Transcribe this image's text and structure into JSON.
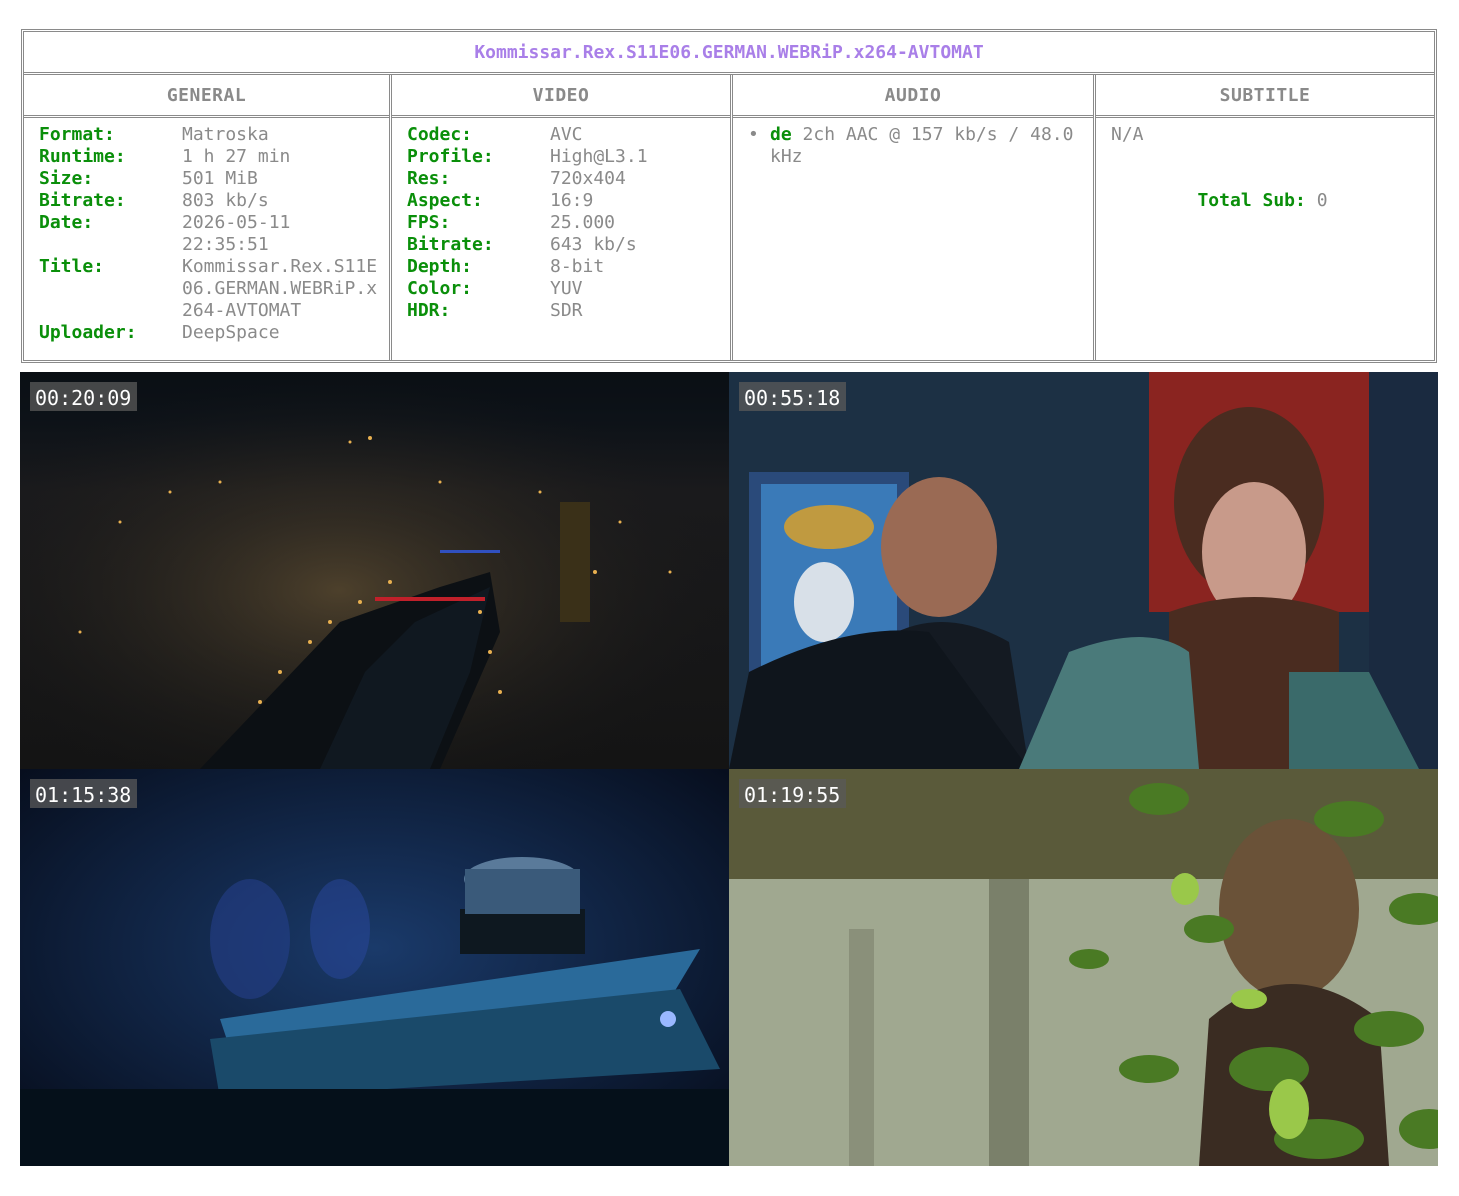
{
  "release_title": "Kommissar.Rex.S11E06.GERMAN.WEBRiP.x264-AVTOMAT",
  "general": {
    "header": "GENERAL",
    "rows": [
      {
        "key": "Format:",
        "value": "Matroska"
      },
      {
        "key": "Runtime:",
        "value": "1 h 27 min"
      },
      {
        "key": "Size:",
        "value": "501 MiB"
      },
      {
        "key": "Bitrate:",
        "value": "803 kb/s"
      },
      {
        "key": "Date:",
        "value": "2026-05-11 22:35:51"
      },
      {
        "key": "Title:",
        "value": "Kommissar.Rex.S11E06.GERMAN.WEBRiP.x264-AVTOMAT"
      },
      {
        "key": "Uploader:",
        "value": "DeepSpace"
      }
    ]
  },
  "video": {
    "header": "VIDEO",
    "rows": [
      {
        "key": "Codec:",
        "value": "AVC"
      },
      {
        "key": "Profile:",
        "value": "High@L3.1"
      },
      {
        "key": "Res:",
        "value": "720x404"
      },
      {
        "key": "Aspect:",
        "value": "16:9"
      },
      {
        "key": "FPS:",
        "value": "25.000"
      },
      {
        "key": "Bitrate:",
        "value": "643 kb/s"
      },
      {
        "key": "Depth:",
        "value": "8-bit"
      },
      {
        "key": "Color:",
        "value": "YUV"
      },
      {
        "key": "HDR:",
        "value": "SDR"
      }
    ]
  },
  "audio": {
    "header": "AUDIO",
    "tracks": [
      {
        "bullet": "•",
        "lang": "de",
        "desc": "2ch AAC @ 157 kb/s / 48.0 kHz"
      }
    ]
  },
  "subtitle": {
    "header": "SUBTITLE",
    "value": "N/A",
    "total_key": "Total Sub:",
    "total_value": "0"
  },
  "screenshots": [
    {
      "timestamp": "00:20:09"
    },
    {
      "timestamp": "00:55:18"
    },
    {
      "timestamp": "01:15:38"
    },
    {
      "timestamp": "01:19:55"
    }
  ],
  "colors": {
    "title": "#a97fe8",
    "key": "#0a8f0a",
    "value": "#8a8a8a",
    "border": "#8a8a8a"
  }
}
